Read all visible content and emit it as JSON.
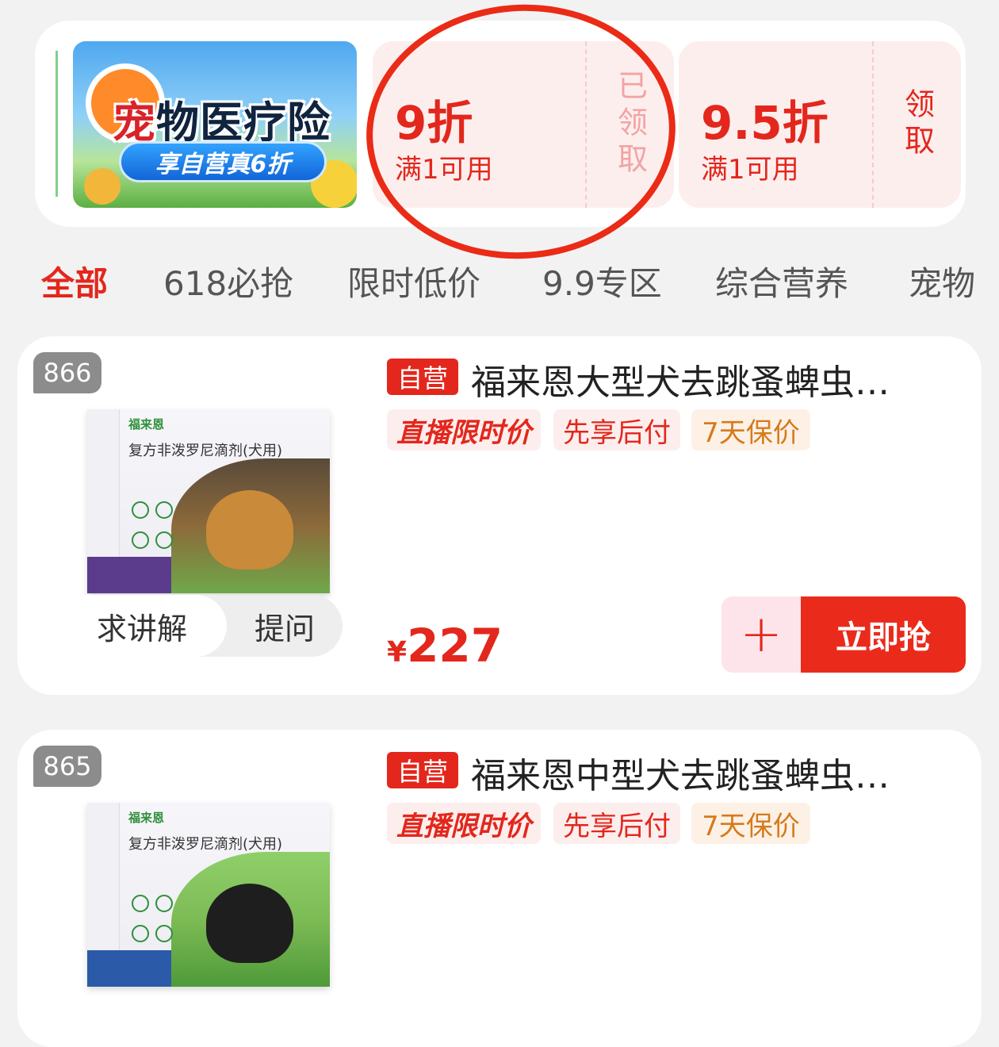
{
  "promo": {
    "title_first": "宠",
    "title_rest": "物医疗险",
    "subtitle": "享自营真6折"
  },
  "coupons": [
    {
      "amount": "9折",
      "condition": "满1可用",
      "action": "已领取"
    },
    {
      "amount": "9.5折",
      "condition": "满1可用",
      "action": "领取"
    }
  ],
  "tabs": [
    "全部",
    "618必抢",
    "限时低价",
    "9.9专区",
    "综合营养",
    "宠物"
  ],
  "products": [
    {
      "rank": "866",
      "badge": "自营",
      "title": "福来恩大型犬去跳蚤蜱虫…",
      "tags": [
        "直播限时价",
        "先享后付",
        "7天保价"
      ],
      "currency": "¥",
      "price": "227",
      "explain_label": "求讲解",
      "question_label": "提问",
      "cart_symbol": "+",
      "buy_label": "立即抢",
      "image": {
        "brand": "福来恩",
        "name": "复方非泼罗尼滴剂(犬用)"
      }
    },
    {
      "rank": "865",
      "badge": "自营",
      "title": "福来恩中型犬去跳蚤蜱虫…",
      "tags": [
        "直播限时价",
        "先享后付",
        "7天保价"
      ],
      "image": {
        "brand": "福来恩",
        "name": "复方非泼罗尼滴剂(犬用)"
      }
    }
  ],
  "colors": {
    "accent": "#e3271c",
    "annotation": "#ea2b16"
  }
}
